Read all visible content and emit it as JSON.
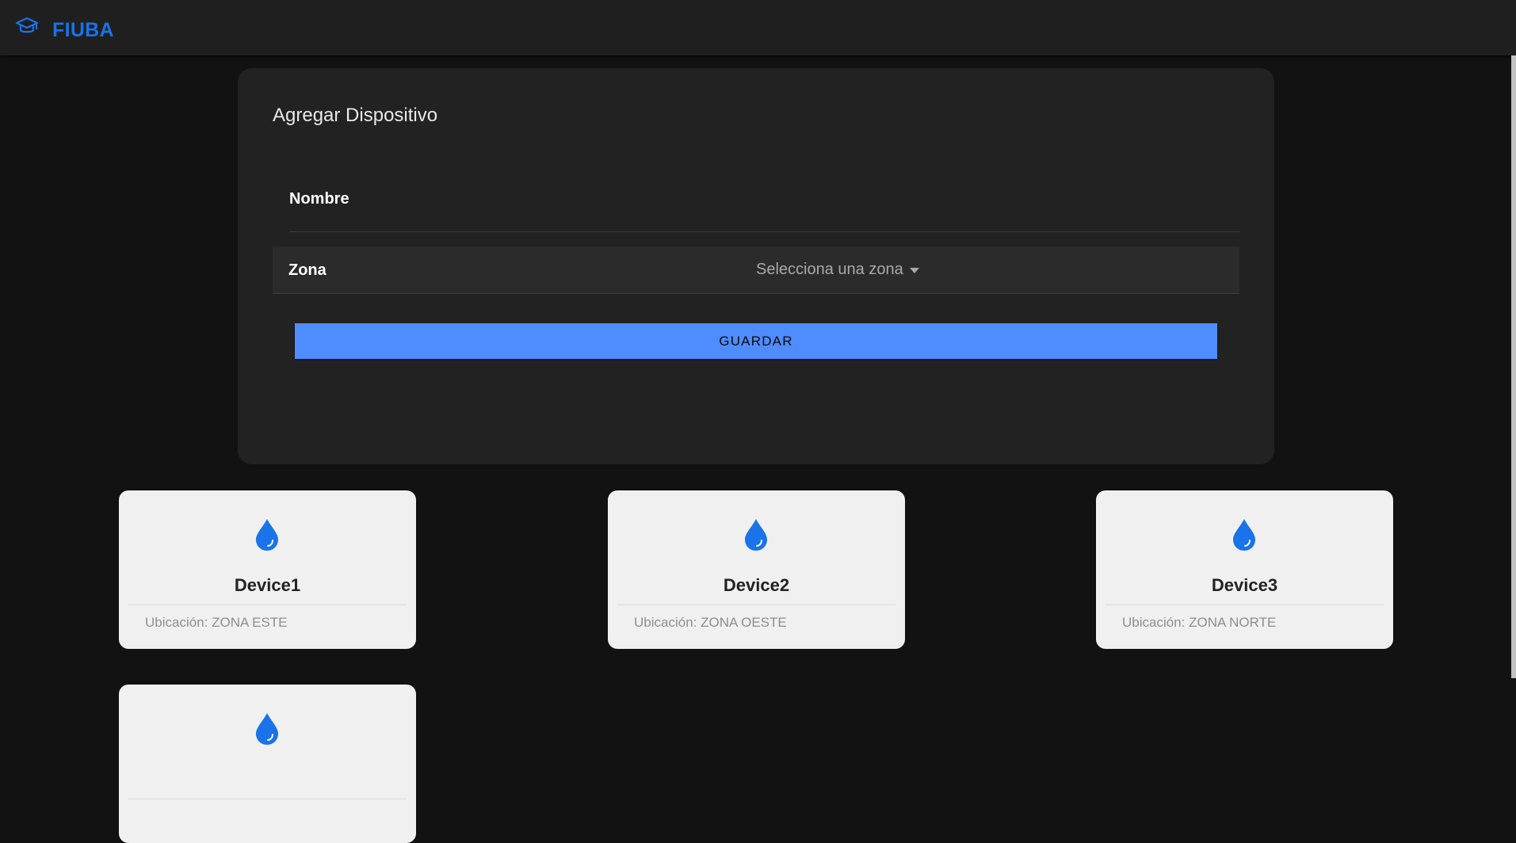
{
  "app": {
    "brand": "FIUBA",
    "brand_icon": "graduation-cap-icon",
    "accent_color": "#1a73e8"
  },
  "form": {
    "title": "Agregar Dispositivo",
    "nombre_label": "Nombre",
    "nombre_value": "",
    "zona_label": "Zona",
    "zona_placeholder": "Selecciona una zona",
    "save_label": "GUARDAR",
    "button_color": "#4f8cff"
  },
  "devices": [
    {
      "name": "Device1",
      "location": "Ubicación: ZONA ESTE",
      "icon": "water-drop-icon"
    },
    {
      "name": "Device2",
      "location": "Ubicación: ZONA OESTE",
      "icon": "water-drop-icon"
    },
    {
      "name": "Device3",
      "location": "Ubicación: ZONA NORTE",
      "icon": "water-drop-icon"
    },
    {
      "name": "",
      "location": "",
      "icon": "water-drop-icon"
    }
  ]
}
